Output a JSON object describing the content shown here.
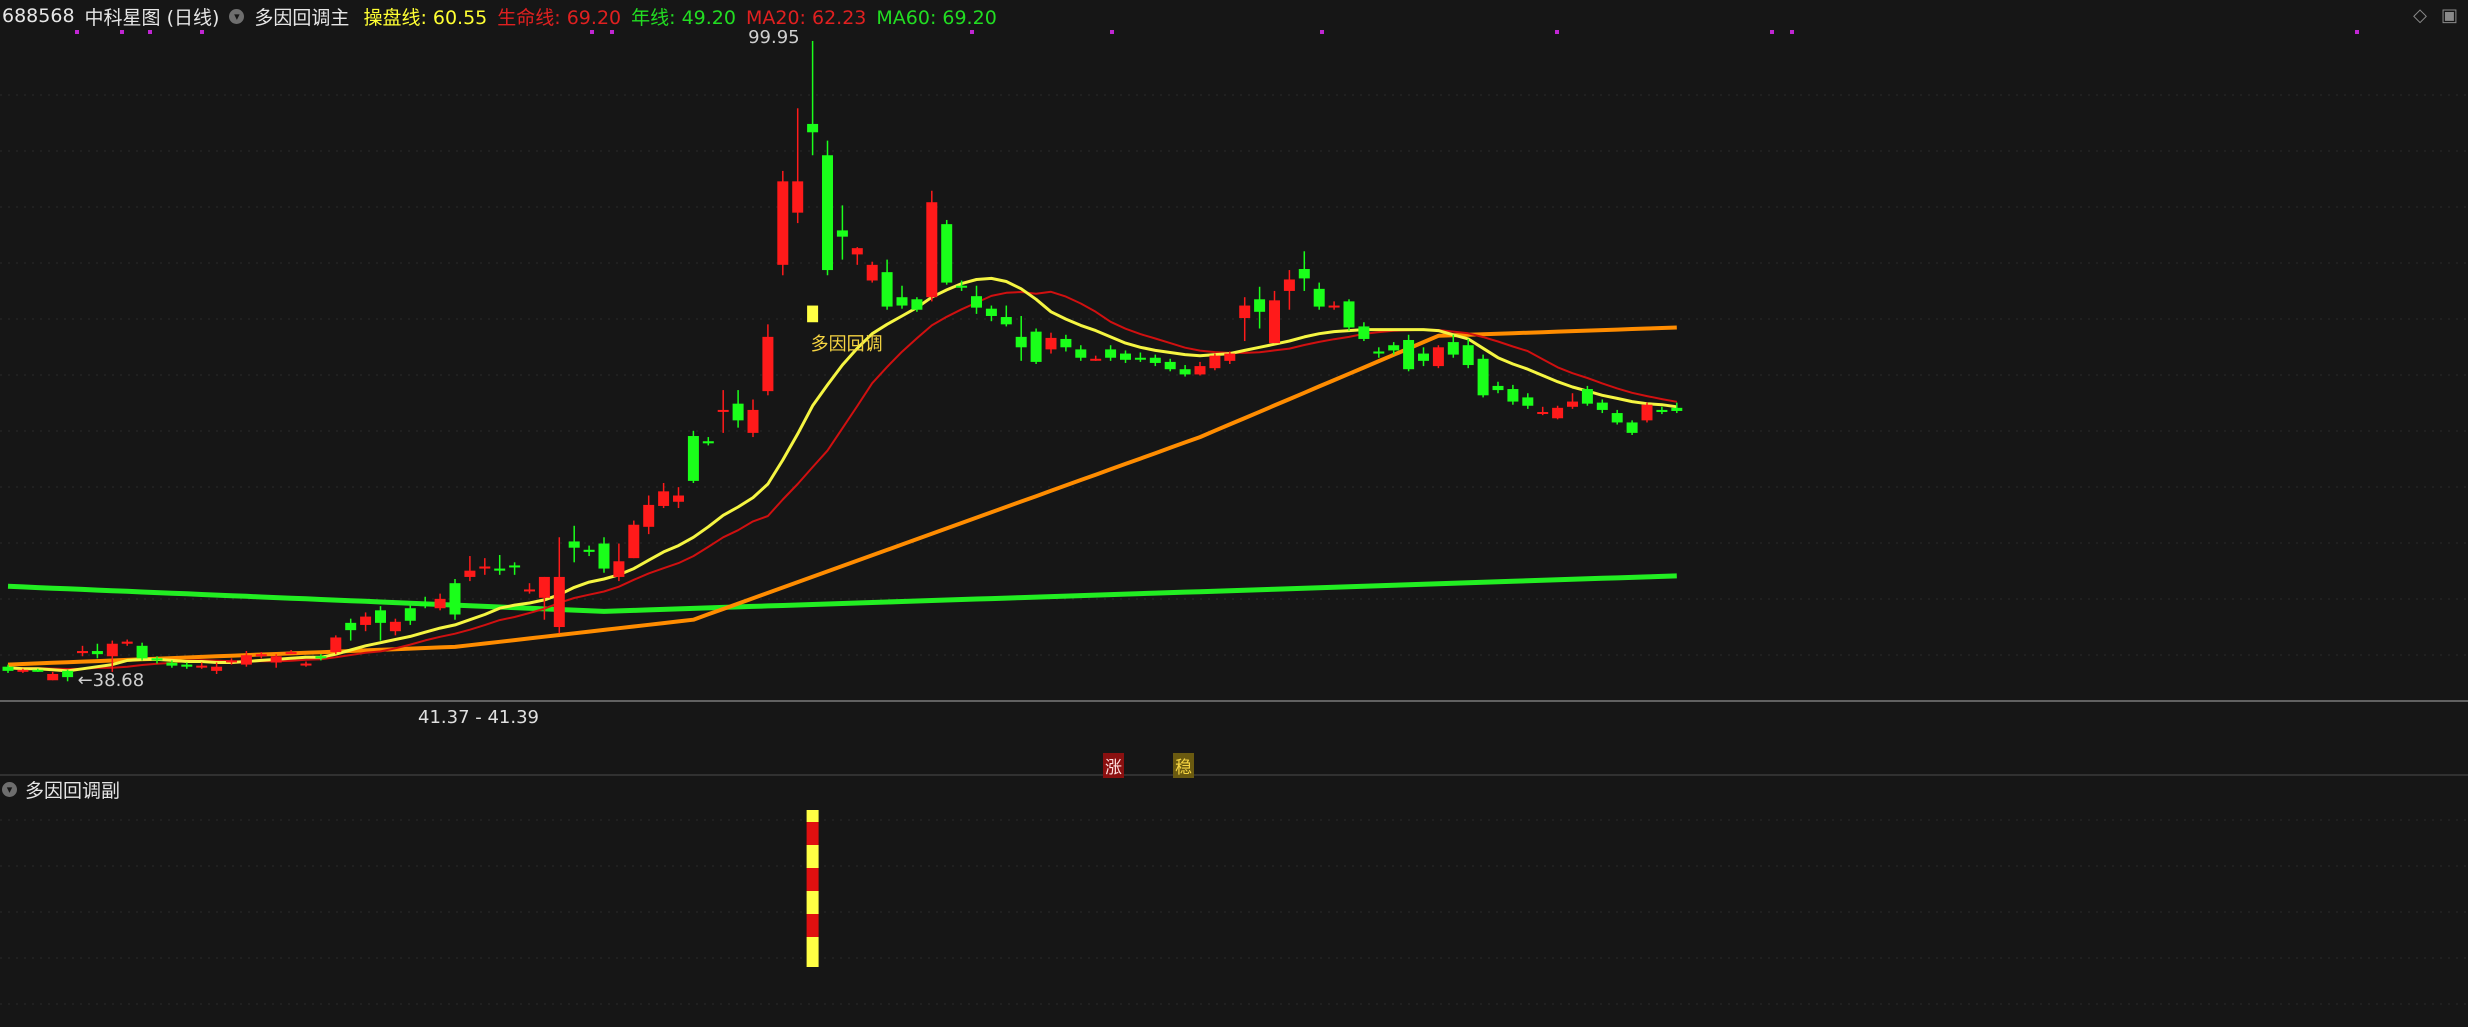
{
  "header": {
    "code": "688568",
    "name": "中科星图",
    "period": "(日线)",
    "indicator_name": "多因回调主",
    "values": [
      {
        "label": "操盘线:",
        "value": "60.55",
        "color": "#ffff33"
      },
      {
        "label": "生命线:",
        "value": "69.20",
        "color": "#e02020"
      },
      {
        "label": "年线:",
        "value": "49.20",
        "color": "#22dd22"
      },
      {
        "label": "MA20:",
        "value": "62.23",
        "color": "#e02020"
      },
      {
        "label": "MA60:",
        "value": "69.20",
        "color": "#22dd22"
      }
    ]
  },
  "sub_panel": {
    "title": "多因回调副"
  },
  "top_right_icons": [
    "diamond-icon",
    "window-icon"
  ],
  "annotations": {
    "high_label": "99.95",
    "low_label": "←38.68",
    "price_range_label": "41.37 - 41.39",
    "signal_label": "多因回调",
    "zhang_tag": "涨",
    "wen_tag": "稳"
  },
  "colors": {
    "up": "#ff1a1a",
    "down": "#1aff1a",
    "yellow_line": "#f5f542",
    "red_line": "#d01010",
    "orange_line": "#ff8c00",
    "green_line": "#22ee22",
    "marker": "#c026d3",
    "background": "#161616"
  },
  "chart_data": {
    "type": "candlestick",
    "ylim": [
      37,
      101
    ],
    "candles": [
      [
        40,
        40.2,
        39.4,
        39.6
      ],
      [
        39.6,
        39.8,
        39.4,
        39.7
      ],
      [
        39.7,
        39.8,
        39.5,
        39.6
      ],
      [
        38.7,
        39.5,
        38.7,
        39.3
      ],
      [
        39.6,
        39.7,
        38.6,
        39
      ],
      [
        41.3,
        42,
        41,
        41.5
      ],
      [
        41.5,
        42.2,
        40.8,
        41.2
      ],
      [
        41,
        42.5,
        39.5,
        42.2
      ],
      [
        42.2,
        42.6,
        42,
        42.4
      ],
      [
        42,
        42.3,
        40.6,
        40.8
      ],
      [
        40.8,
        41,
        40.3,
        40.6
      ],
      [
        40.4,
        40.6,
        39.9,
        40.1
      ],
      [
        40.2,
        40.4,
        39.8,
        40
      ],
      [
        40,
        40.4,
        39.8,
        40.1
      ],
      [
        39.6,
        40.4,
        39.3,
        40
      ],
      [
        40.5,
        40.8,
        40.2,
        40.6
      ],
      [
        40.2,
        41.5,
        40,
        41.1
      ],
      [
        41,
        41.4,
        40.8,
        41.2
      ],
      [
        40.4,
        41.2,
        39.9,
        41
      ],
      [
        41.4,
        41.6,
        41.3,
        41.4
      ],
      [
        40.2,
        40.5,
        40,
        40.3
      ],
      [
        41,
        41.2,
        40.6,
        40.8
      ],
      [
        41.4,
        43,
        41.2,
        42.8
      ],
      [
        44.2,
        44.6,
        42.5,
        43.5
      ],
      [
        44,
        45.2,
        43.4,
        44.8
      ],
      [
        45.4,
        45.8,
        42.5,
        44.2
      ],
      [
        43.4,
        44.6,
        43,
        44.3
      ],
      [
        45.6,
        45.9,
        44,
        44.4
      ],
      [
        46.1,
        46.7,
        45.6,
        45.8
      ],
      [
        45.6,
        47,
        45.4,
        46.5
      ],
      [
        48,
        48.4,
        44.5,
        45
      ],
      [
        48.6,
        50.6,
        48.2,
        49.2
      ],
      [
        49.4,
        50.4,
        48.8,
        49.6
      ],
      [
        49.4,
        50.7,
        48.8,
        49.2
      ],
      [
        49.7,
        50,
        48.8,
        49.6
      ],
      [
        47.4,
        48,
        47,
        47.4
      ],
      [
        46.6,
        48.6,
        44.5,
        48.6
      ],
      [
        43.8,
        52.4,
        43.2,
        48.6
      ],
      [
        52,
        53.5,
        50,
        51.4
      ],
      [
        51.2,
        51.6,
        50.6,
        51
      ],
      [
        51.8,
        52.4,
        49,
        49.4
      ],
      [
        48.6,
        51.8,
        48.2,
        50.1
      ],
      [
        50.4,
        54,
        50.4,
        53.6
      ],
      [
        53.4,
        56.4,
        52.7,
        55.5
      ],
      [
        55.4,
        57.6,
        55.2,
        56.8
      ],
      [
        55.8,
        57.2,
        55.2,
        56.4
      ],
      [
        62.1,
        62.6,
        57.6,
        57.8
      ],
      [
        61.6,
        62,
        61.2,
        61.4
      ],
      [
        64.5,
        66.5,
        62.4,
        64.6
      ],
      [
        65.2,
        66.5,
        62.9,
        63.6
      ],
      [
        62.4,
        65.6,
        62,
        64.6
      ],
      [
        66.4,
        72.8,
        66,
        71.6
      ],
      [
        78.5,
        87.5,
        77.5,
        86.5
      ],
      [
        83.5,
        93.5,
        82.5,
        86.5
      ],
      [
        92,
        99.95,
        89,
        91.2
      ],
      [
        89,
        90.4,
        77.5,
        78
      ],
      [
        81.8,
        84.2,
        79,
        81.2
      ],
      [
        79.5,
        80.2,
        78.5,
        80.1
      ],
      [
        77,
        78.8,
        76.8,
        78.5
      ],
      [
        77.8,
        79,
        74.2,
        74.5
      ],
      [
        75.4,
        76.5,
        74.3,
        74.6
      ],
      [
        75.2,
        75.4,
        74,
        74.2
      ],
      [
        75.4,
        85.6,
        75,
        84.5
      ],
      [
        82.4,
        82.8,
        76.6,
        76.8
      ],
      [
        76.5,
        77,
        76,
        76.4
      ],
      [
        75.5,
        76.5,
        73.8,
        74.4
      ],
      [
        74.3,
        74.6,
        73.1,
        73.6
      ],
      [
        73.5,
        74.6,
        72.6,
        72.8
      ],
      [
        71.6,
        73.6,
        69.3,
        70.6
      ],
      [
        72.1,
        72.4,
        69,
        69.2
      ],
      [
        70.4,
        72,
        70,
        71.5
      ],
      [
        71.4,
        71.8,
        70.2,
        70.6
      ],
      [
        70.4,
        70.8,
        69.3,
        69.6
      ],
      [
        69.5,
        69.8,
        69.3,
        69.5
      ],
      [
        70.4,
        70.8,
        69.3,
        69.6
      ],
      [
        70,
        70.3,
        69.1,
        69.4
      ],
      [
        69.6,
        70.1,
        69.2,
        69.5
      ],
      [
        69.6,
        69.9,
        68.8,
        69.1
      ],
      [
        69.2,
        69.5,
        68.3,
        68.5
      ],
      [
        68.5,
        68.9,
        67.8,
        68
      ],
      [
        68,
        69.2,
        67.9,
        68.8
      ],
      [
        68.6,
        70,
        68.4,
        69.8
      ],
      [
        69.3,
        70.2,
        69,
        70
      ],
      [
        73.4,
        75.4,
        71.2,
        74.6
      ],
      [
        75.2,
        76.4,
        72.4,
        74
      ],
      [
        71,
        76,
        71,
        75.1
      ],
      [
        76,
        78,
        74.2,
        77.1
      ],
      [
        78.1,
        79.8,
        76,
        77.2
      ],
      [
        76.2,
        76.8,
        74.2,
        74.5
      ],
      [
        74.6,
        75,
        74.2,
        74.6
      ],
      [
        75,
        75.2,
        72.2,
        72.5
      ],
      [
        72.6,
        73,
        71.2,
        71.4
      ],
      [
        70.2,
        70.6,
        69.6,
        70
      ],
      [
        70.8,
        71.1,
        69.9,
        70.3
      ],
      [
        71.3,
        71.8,
        68.3,
        68.5
      ],
      [
        70,
        70.6,
        68.8,
        69.3
      ],
      [
        68.8,
        70.8,
        68.6,
        70.6
      ],
      [
        71.1,
        71.8,
        69.6,
        69.9
      ],
      [
        70.8,
        71.4,
        68.6,
        68.9
      ],
      [
        69.5,
        69.9,
        65.8,
        66
      ],
      [
        66.9,
        67.3,
        66.2,
        66.5
      ],
      [
        66.6,
        67,
        65.1,
        65.4
      ],
      [
        65.8,
        66.2,
        64.7,
        65
      ],
      [
        64.4,
        64.9,
        64.1,
        64.4
      ],
      [
        63.8,
        65,
        63.7,
        64.8
      ],
      [
        64.9,
        66.2,
        64.7,
        65.4
      ],
      [
        66.6,
        66.9,
        65,
        65.2
      ],
      [
        65.3,
        65.6,
        64.3,
        64.6
      ],
      [
        64.3,
        64.6,
        63.2,
        63.4
      ],
      [
        63.4,
        63.6,
        62.2,
        62.4
      ],
      [
        63.6,
        65.3,
        63.4,
        65.1
      ],
      [
        64.6,
        64.9,
        64.2,
        64.4
      ],
      [
        64.8,
        65.3,
        64.3,
        64.5
      ]
    ],
    "lines": {
      "operating_line": [
        39.9,
        39.8,
        39.8,
        39.7,
        39.6,
        39.8,
        40,
        40.2,
        40.6,
        40.7,
        40.7,
        40.6,
        40.5,
        40.5,
        40.4,
        40.4,
        40.5,
        40.6,
        40.7,
        40.8,
        40.9,
        40.9,
        41.2,
        41.6,
        42,
        42.3,
        42.6,
        42.9,
        43.3,
        43.7,
        44,
        44.5,
        45,
        45.6,
        45.9,
        46.1,
        46.4,
        46.9,
        47.6,
        48.1,
        48.4,
        48.8,
        49.4,
        50.2,
        51,
        51.6,
        52.4,
        53.4,
        54.5,
        55.3,
        56.2,
        57.5,
        59.8,
        62.3,
        65,
        67,
        68.9,
        70.5,
        71.9,
        72.8,
        73.6,
        74.4,
        75.4,
        76.1,
        76.7,
        77.1,
        77.2,
        76.9,
        76.2,
        75.2,
        74,
        73.3,
        72.7,
        72.2,
        71.6,
        71,
        70.6,
        70.3,
        70.1,
        69.9,
        69.8,
        69.9,
        70,
        70.3,
        70.6,
        70.9,
        71.2,
        71.6,
        71.9,
        72.1,
        72.2,
        72.3,
        72.3,
        72.3,
        72.3,
        72.3,
        72.2,
        71.8,
        71.4,
        70.5,
        69.6,
        69,
        68.5,
        67.9,
        67.3,
        66.8,
        66.4,
        66,
        65.7,
        65.4,
        65.2,
        65.1,
        64.9
      ]
    },
    "long_lines": {
      "life_line_start": 40.2,
      "annual_line_start": 47.7,
      "annual_line_end": 45.4
    }
  }
}
